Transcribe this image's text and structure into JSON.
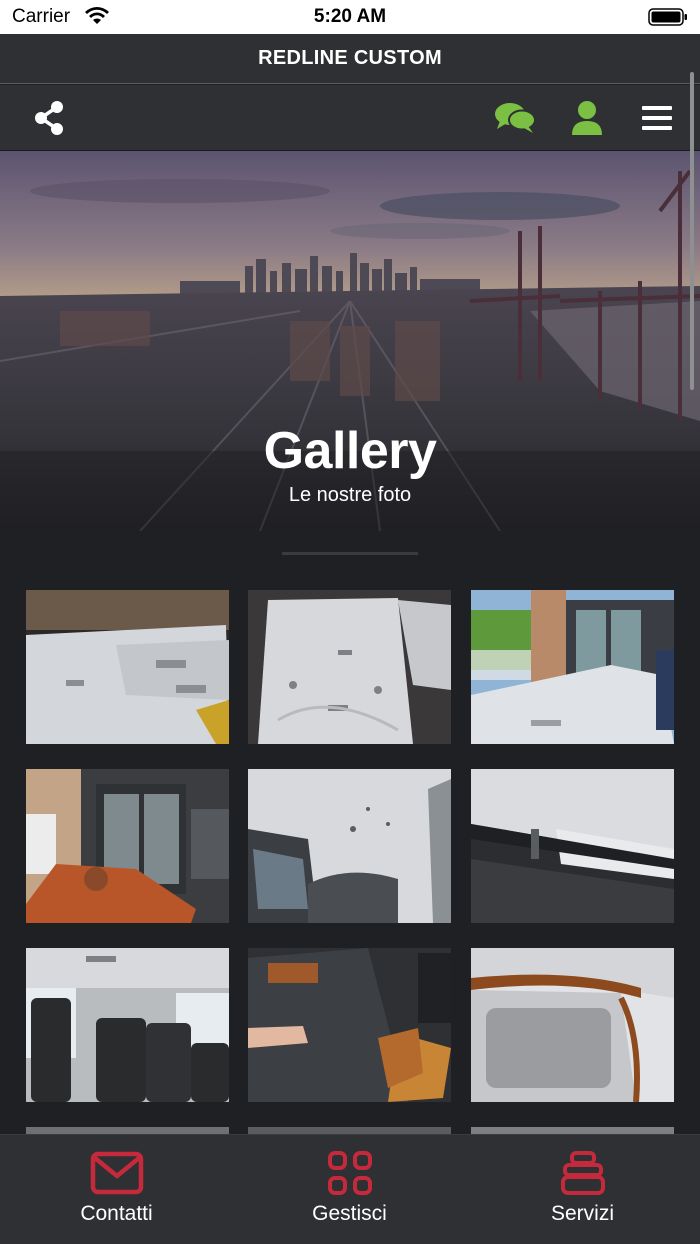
{
  "status_bar": {
    "carrier": "Carrier",
    "time": "5:20 AM"
  },
  "header": {
    "title": "REDLINE CUSTOM"
  },
  "toolbar": {
    "share_icon": "share-icon",
    "chat_icon": "chat-icon",
    "user_icon": "user-icon",
    "menu_icon": "hamburger-menu-icon"
  },
  "hero": {
    "title": "Gallery",
    "subtitle": "Le nostre foto"
  },
  "tabs": [
    {
      "label": "Contatti",
      "icon": "mail-icon"
    },
    {
      "label": "Gestisci",
      "icon": "grid-icon"
    },
    {
      "label": "Servizi",
      "icon": "stack-icon"
    }
  ],
  "colors": {
    "accent_green": "#7bc043",
    "accent_red": "#c42a3c",
    "background": "#1f2023",
    "bar": "#2f3033"
  }
}
